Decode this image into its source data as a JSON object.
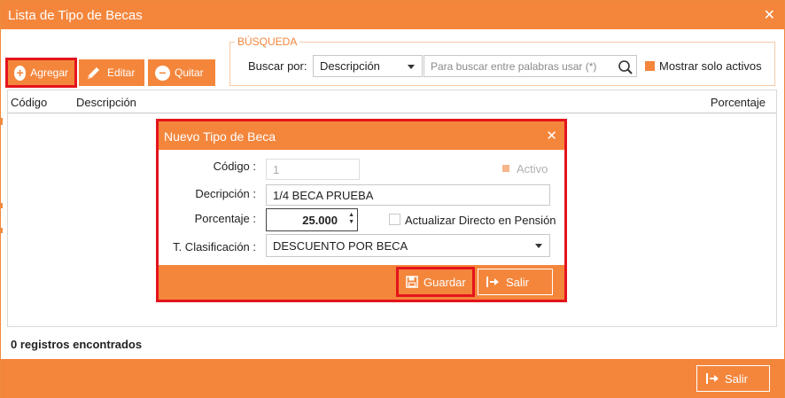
{
  "window": {
    "title": "Lista de Tipo de Becas",
    "close_glyph": "✕"
  },
  "toolbar": {
    "add_label": "Agregar",
    "edit_label": "Editar",
    "remove_label": "Quitar"
  },
  "search": {
    "legend": "BÚSQUEDA",
    "search_by_label": "Buscar por:",
    "field_selected": "Descripción",
    "placeholder": "Para buscar entre palabras usar (*)",
    "only_active_label": "Mostrar solo activos",
    "only_active_checked": true
  },
  "grid": {
    "columns": [
      "Código",
      "Descripción",
      "Porcentaje"
    ],
    "rows": []
  },
  "status": {
    "records_text": "0 registros encontrados"
  },
  "footer": {
    "exit_label": "Salir"
  },
  "modal": {
    "title": "Nuevo Tipo de Beca",
    "close_glyph": "✕",
    "code_label": "Código :",
    "code_value": "1",
    "active_label": "Activo",
    "active_checked": true,
    "description_label": "Decripción :",
    "description_value": "1/4 BECA PRUEBA",
    "percentage_label": "Porcentaje :",
    "percentage_value": "25.000",
    "direct_update_label": "Actualizar Directo en Pensión",
    "direct_update_checked": false,
    "classification_label": "T. Clasificación :",
    "classification_value": "DESCUENTO POR BECA",
    "save_label": "Guardar",
    "exit_label": "Salir"
  },
  "colors": {
    "accent": "#f4863c",
    "highlight": "#e4141c",
    "group_border": "#f6c9a6"
  },
  "icons": {
    "add": "plus-circle-icon",
    "edit": "pencil-icon",
    "remove": "minus-circle-icon",
    "search": "magnifier-icon",
    "save": "floppy-disk-icon",
    "exit": "exit-arrow-icon",
    "dropdown": "caret-down-icon"
  }
}
